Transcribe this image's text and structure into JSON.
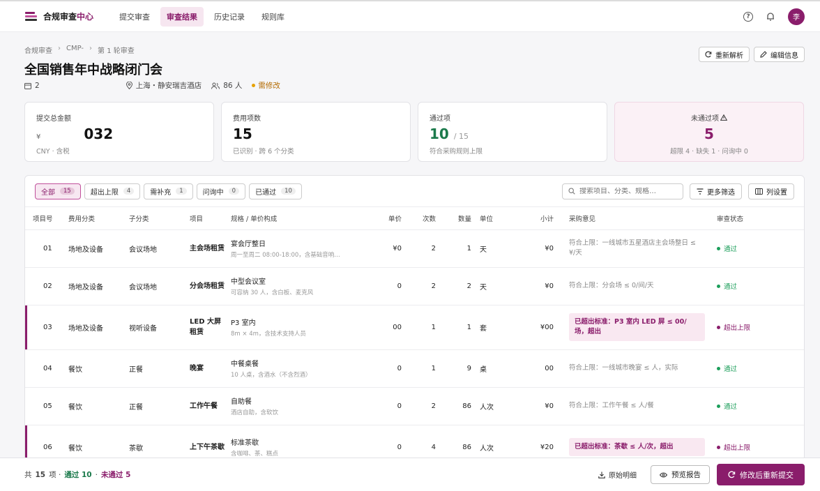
{
  "app": {
    "name_prefix": "合规审查",
    "name_accent": "中心",
    "nav": [
      {
        "label": "提交审查",
        "active": false
      },
      {
        "label": "审查结果",
        "active": true
      },
      {
        "label": "历史记录",
        "active": false
      },
      {
        "label": "规则库",
        "active": false
      }
    ],
    "help_icon": "?",
    "avatar": "李"
  },
  "header": {
    "breadcrumb": [
      "合规审查",
      "CMP-",
      "第 1 轮审查"
    ],
    "title": "全国销售年中战略闭门会",
    "meta": {
      "date_prefix": "2",
      "location": "上海・静安瑞吉酒店",
      "people": "86 人",
      "status": "需修改"
    },
    "buttons": {
      "reparse": "重新解析",
      "edit": "编辑信息"
    }
  },
  "cards": [
    {
      "label": "提交总金额",
      "unit": "¥",
      "value": "032",
      "sub": "CNY · 含税"
    },
    {
      "label": "费用项数",
      "value": "15",
      "sub": "已识别 · 跨 6 个分类"
    },
    {
      "label": "通过项",
      "value": "10",
      "total": "/ 15",
      "sub": "符合采购规则上限"
    },
    {
      "label": "未通过项",
      "value": "5",
      "sub": "超限 4 · 缺失 1 · 问询中 0"
    }
  ],
  "filters": [
    {
      "label": "全部",
      "count": "15",
      "active": true
    },
    {
      "label": "超出上限",
      "count": "4",
      "active": false
    },
    {
      "label": "需补充",
      "count": "1",
      "active": false
    },
    {
      "label": "问询中",
      "count": "0",
      "active": false
    },
    {
      "label": "已通过",
      "count": "10",
      "active": false
    }
  ],
  "search": {
    "placeholder": "搜索项目、分类、规格…"
  },
  "tools": {
    "more_filter": "更多筛选",
    "columns": "列设置"
  },
  "table": {
    "headers": [
      "项目号",
      "费用分类",
      "子分类",
      "项目",
      "规格 / 单价构成",
      "单价",
      "次数",
      "数量",
      "单位",
      "小计",
      "采购意见",
      "审查状态"
    ],
    "rows": [
      {
        "no": "01",
        "cat": "场地及设备",
        "sub": "会议场地",
        "item": "主会场租赁",
        "spec": "宴会厅整日",
        "spec_sub": "周一至周二 08:00-18:00，含基础音响…",
        "price": "¥0",
        "times": "2",
        "qty": "1",
        "unit": "天",
        "subtotal": "¥0",
        "opinion": "符合上限：一线城市五星酒店主会场整日 ≤ ¥/天",
        "status": "通过",
        "flag": false
      },
      {
        "no": "02",
        "cat": "场地及设备",
        "sub": "会议场地",
        "item": "分会场租赁",
        "spec": "中型会议室",
        "spec_sub": "可容纳 30 人，含白板、麦克风",
        "price": "0",
        "times": "2",
        "qty": "2",
        "unit": "天",
        "subtotal": "¥0",
        "opinion": "符合上限：分会场 ≤ 0/间/天",
        "status": "通过",
        "flag": false
      },
      {
        "no": "03",
        "cat": "场地及设备",
        "sub": "视听设备",
        "item": "LED 大屏租赁",
        "spec": "P3 室内",
        "spec_sub": "8m × 4m，含技术支持人员",
        "price": "00",
        "times": "1",
        "qty": "1",
        "unit": "套",
        "subtotal": "¥00",
        "opinion": "已超出标准：P3 室内 LED 屏 ≤ 00/场，超出",
        "status": "超出上限",
        "flag": true
      },
      {
        "no": "04",
        "cat": "餐饮",
        "sub": "正餐",
        "item": "晚宴",
        "spec": "中餐桌餐",
        "spec_sub": "10 人桌，含酒水（不含烈酒）",
        "price": "0",
        "times": "1",
        "qty": "9",
        "unit": "桌",
        "subtotal": "00",
        "opinion": "符合上限：一线城市晚宴 ≤ 人，实际",
        "status": "通过",
        "flag": false
      },
      {
        "no": "05",
        "cat": "餐饮",
        "sub": "正餐",
        "item": "工作午餐",
        "spec": "自助餐",
        "spec_sub": "酒店自助，含软饮",
        "price": "0",
        "times": "2",
        "qty": "86",
        "unit": "人次",
        "subtotal": "¥0",
        "opinion": "符合上限：工作午餐 ≤ 人/餐",
        "status": "通过",
        "flag": false
      },
      {
        "no": "06",
        "cat": "餐饮",
        "sub": "茶歇",
        "item": "上下午茶歇",
        "spec": "标准茶歇",
        "spec_sub": "含咖啡、茶、糕点",
        "price": "0",
        "times": "4",
        "qty": "86",
        "unit": "人次",
        "subtotal": "¥20",
        "opinion": "已超出标准：茶歇 ≤ 人/次，超出",
        "status": "超出上限",
        "flag": true
      }
    ]
  },
  "footer": {
    "total_prefix": "共",
    "total": "15",
    "total_suffix": "项 ·",
    "passed": "通过 10",
    "dot": "·",
    "failed": "未通过 5",
    "raw": "原始明细",
    "preview": "预览报告",
    "resubmit": "修改后重新提交"
  },
  "colors": {
    "brand": "#8a1d6b",
    "pass": "#1b9e5a",
    "warn": "#e6a100",
    "fail": "#8a1d6b"
  }
}
